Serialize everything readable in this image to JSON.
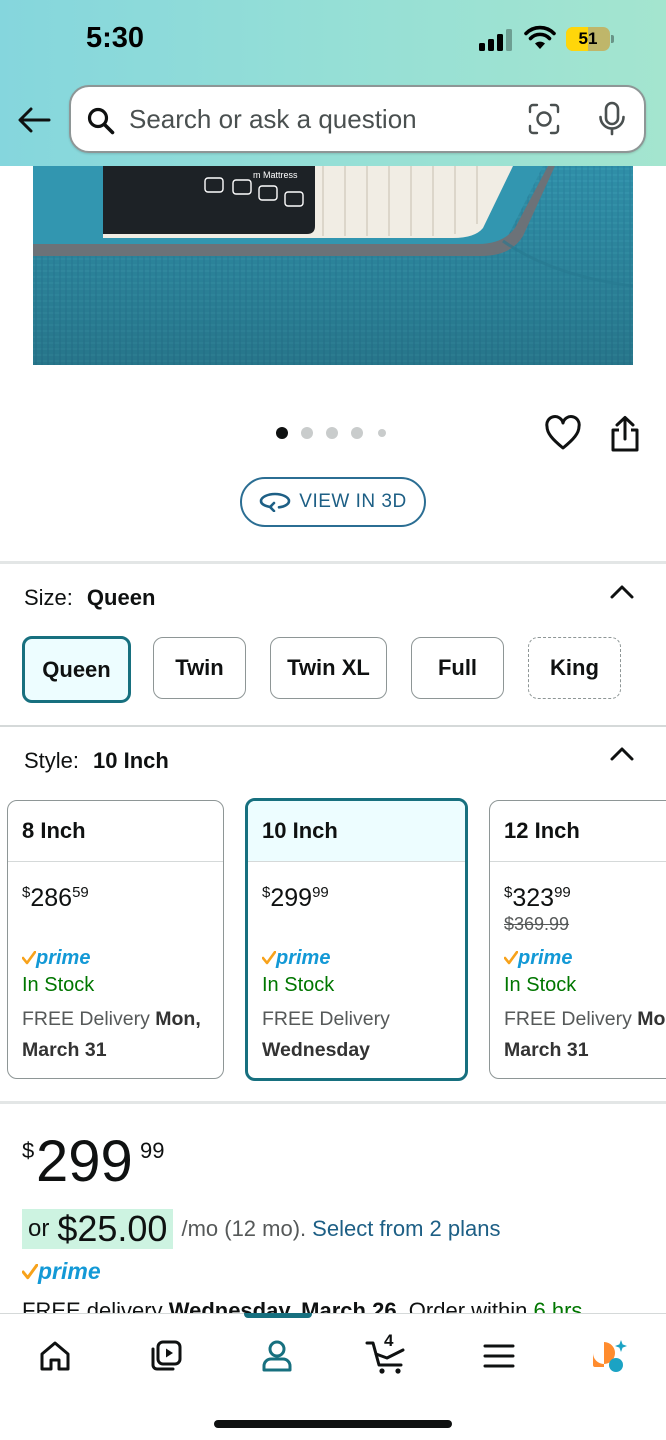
{
  "status_bar": {
    "time": "5:30",
    "battery": "51"
  },
  "search": {
    "placeholder": "Search or ask a question"
  },
  "carousel": {
    "total": 5,
    "active_index": 0
  },
  "view_3d": {
    "label": "VIEW IN 3D"
  },
  "size": {
    "label": "Size:",
    "selected": "Queen",
    "options": [
      "Queen",
      "Twin",
      "Twin XL",
      "Full",
      "King"
    ]
  },
  "style": {
    "label": "Style:",
    "selected": "10 Inch",
    "cards": [
      {
        "name": "8 Inch",
        "price_symbol": "$",
        "price_whole": "286",
        "price_cents": "59",
        "list_price": "",
        "prime": "prime",
        "stock": "In Stock",
        "delivery_prefix": "FREE Delivery",
        "delivery_day": "Mon,",
        "delivery_date": "March 31"
      },
      {
        "name": "10 Inch",
        "price_symbol": "$",
        "price_whole": "299",
        "price_cents": "99",
        "list_price": "",
        "prime": "prime",
        "stock": "In Stock",
        "delivery_prefix": "FREE Delivery",
        "delivery_day": "",
        "delivery_date": "Wednesday"
      },
      {
        "name": "12 Inch",
        "price_symbol": "$",
        "price_whole": "323",
        "price_cents": "99",
        "list_price": "$369.99",
        "prime": "prime",
        "stock": "In Stock",
        "delivery_prefix": "FREE Delivery",
        "delivery_day": "Mon",
        "delivery_date": "March 31"
      }
    ]
  },
  "price": {
    "symbol": "$",
    "whole": "299",
    "cents": "99",
    "installment_prefix": "or",
    "installment_amount": "$25.00",
    "installment_term": "/mo (12 mo).",
    "installment_link": "Select from 2 plans",
    "prime": "prime",
    "delivery_prefix": "FREE delivery",
    "delivery_date": "Wednesday, March 26.",
    "delivery_order": "Order within",
    "delivery_time": "6 hrs"
  },
  "bottom_nav": {
    "cart_count": "4"
  },
  "colors": {
    "accent": "#17707f",
    "link": "#1d5f85",
    "prime": "#1399d6",
    "in_stock": "#007600",
    "header_from": "#85d6dd",
    "header_to": "#a4e5cf"
  }
}
